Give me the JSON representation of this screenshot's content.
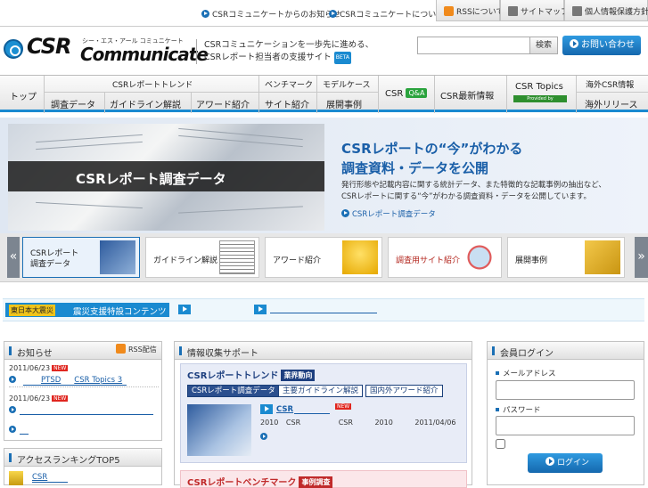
{
  "topbar": {
    "link1": "CSRコミュニケートからのお知らせ",
    "link2": "CSRコミュニケートについて",
    "rss": "RSSについて",
    "sitemap": "サイトマップ",
    "privacy": "個人情報保護方針"
  },
  "header": {
    "logo_main": "CSR",
    "logo_sub": "Communicate",
    "logo_kana": "シー・エス・アール コミュニケート",
    "tagline1": "CSRコミュニケーションを一歩先に進める、",
    "tagline2": "CSRレポート担当者の支援サイト",
    "beta": "BETA",
    "search_placeholder": "",
    "search_btn": "検索",
    "contact_btn": "お問い合わせ"
  },
  "nav": {
    "top": "トップ",
    "trend_group": "CSRレポートトレンド",
    "survey": "調査データ",
    "guideline": "ガイドライン解説",
    "award": "アワード紹介",
    "benchmark": "ベンチマーク",
    "model": "モデルケース",
    "site_intro": "サイト紹介",
    "cases": "展開事例",
    "csr_qa": "CSR",
    "qa_badge": "Q&A",
    "latest": "CSR最新情報",
    "topics": "CSR Topics",
    "provided": "Provided by",
    "overseas": "海外CSR情報",
    "overseas_release": "海外リリース"
  },
  "hero": {
    "band_text": "CSRレポート調査データ",
    "headline1": "CSRレポートの“今”がわかる",
    "headline2": "調査資料・データを公開",
    "desc1": "発行形態や記載内容に関する統計データ、また特徴的な記載事例の抽出など、",
    "desc2": "CSRレポートに関する“今”がわかる調査資料・データを公開しています。",
    "link": "CSRレポート調査データ"
  },
  "carousel": {
    "prev": "«",
    "next": "»",
    "items": [
      "CSRレポート",
      "調査データ",
      "ガイドライン解説",
      "アワード紹介",
      "調査用サイト紹介",
      "展開事例"
    ]
  },
  "disaster": {
    "tag": "東日本大震災",
    "text": "震災支援特設コンテンツ"
  },
  "news": {
    "title": "お知らせ",
    "rss": "RSS配信",
    "items": [
      {
        "date": "2011/06/23",
        "new": "NEW",
        "text1": "PTSD",
        "text2": "CSR Topics 3"
      },
      {
        "date": "2011/06/23",
        "new": "NEW",
        "text1": "",
        "text2": ""
      }
    ]
  },
  "ranking": {
    "title": "アクセスランキングTOP5",
    "item1": "CSR"
  },
  "info": {
    "title": "情報収集サポート",
    "trend": "CSRレポートトレンド",
    "trend_tag": "業界動向",
    "tabs": [
      "CSRレポート調査データ",
      "主要ガイドライン解説",
      "国内外アワード紹介"
    ],
    "article_title": "CSR",
    "article_new": "NEW",
    "meta": [
      "2010",
      "CSR",
      "CSR",
      "2010",
      "2011/04/06"
    ],
    "bench": "CSRレポートベンチマーク",
    "bench_tag": "事例調査"
  },
  "login": {
    "title": "会員ログイン",
    "email": "メールアドレス",
    "password": "パスワード",
    "btn": "ログイン"
  }
}
